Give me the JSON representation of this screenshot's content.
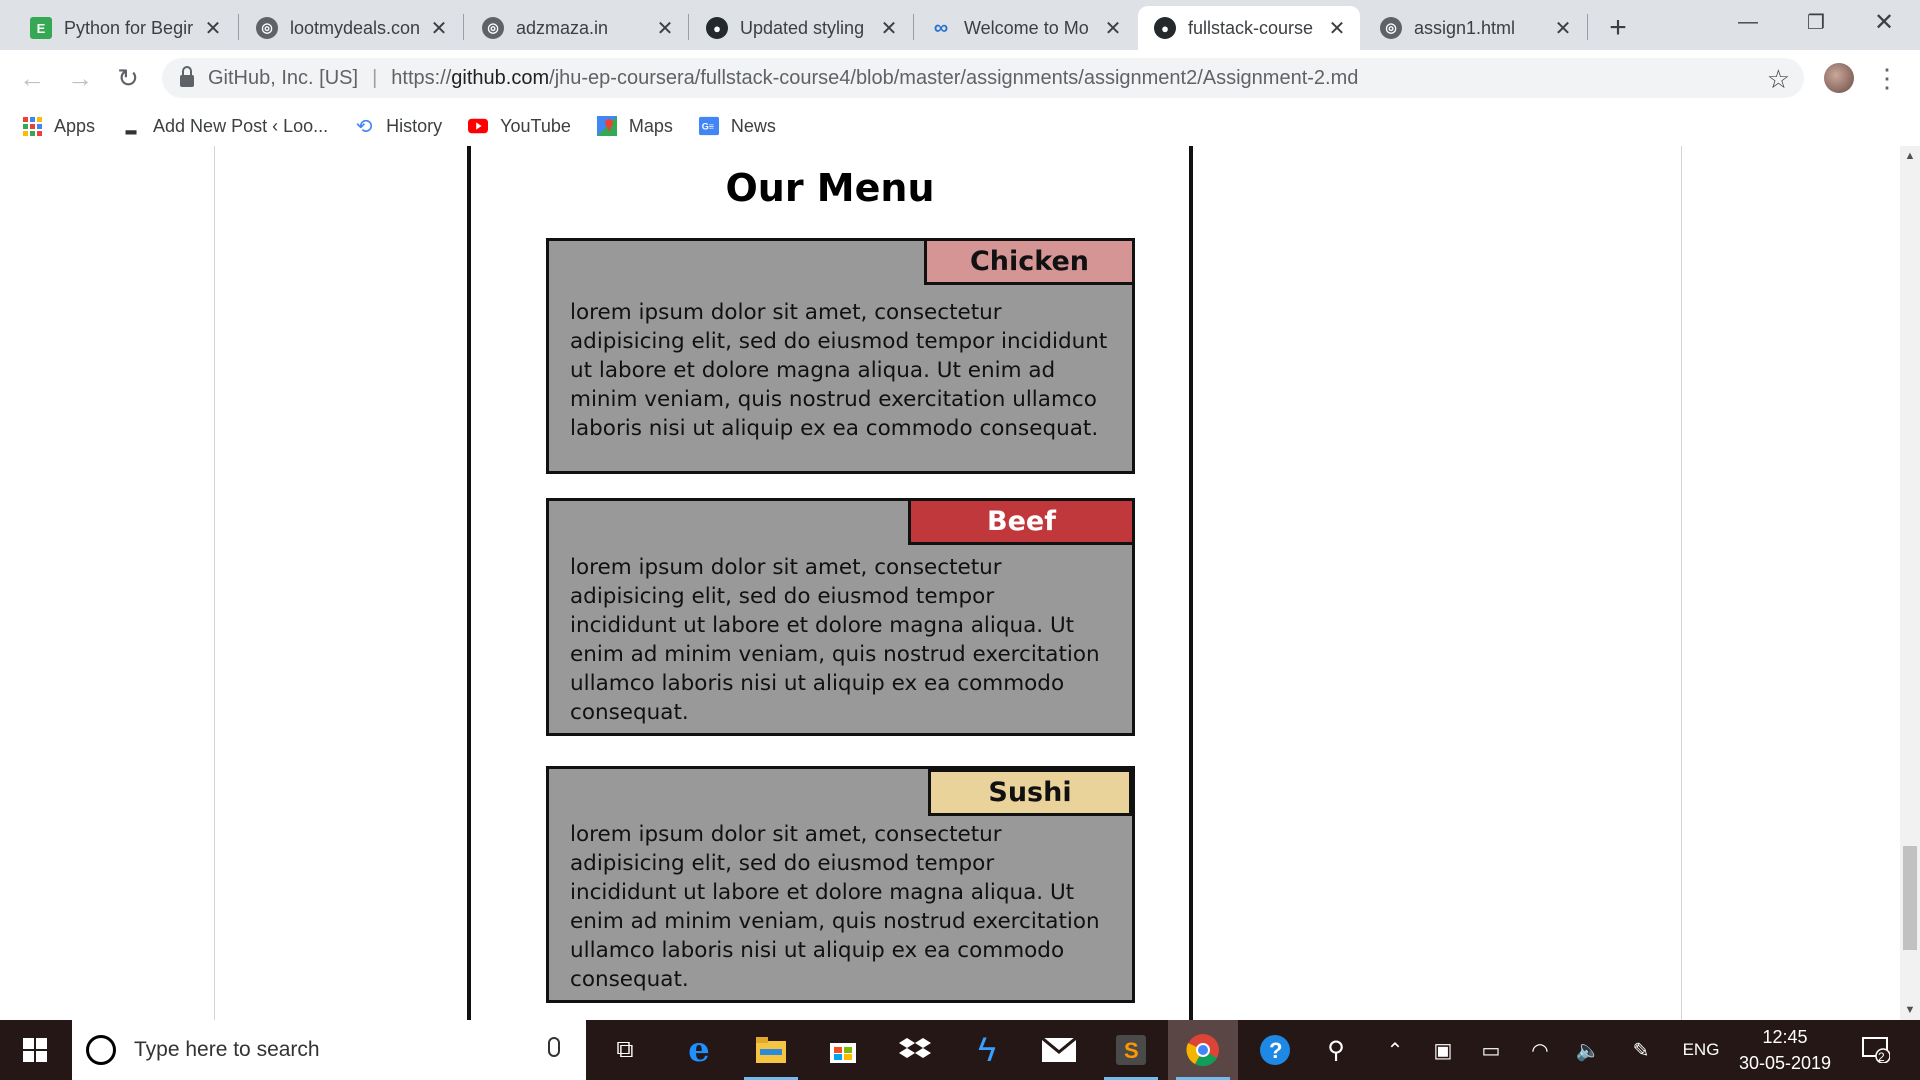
{
  "browser": {
    "tabs": [
      {
        "title": "Python for Begir",
        "favicon_color": "#34a853",
        "favicon_glyph": "E"
      },
      {
        "title": "lootmydeals.con",
        "favicon_color": "#5f6368",
        "favicon_glyph": "globe"
      },
      {
        "title": "adzmaza.in",
        "favicon_color": "#5f6368",
        "favicon_glyph": "globe"
      },
      {
        "title": "Updated styling",
        "favicon_color": "#24292e",
        "favicon_glyph": "github"
      },
      {
        "title": "Welcome to Mo",
        "favicon_color": "#2a73cc",
        "favicon_glyph": "∞"
      },
      {
        "title": "fullstack-course",
        "favicon_color": "#24292e",
        "favicon_glyph": "github"
      },
      {
        "title": "assign1.html",
        "favicon_color": "#5f6368",
        "favicon_glyph": "globe"
      }
    ],
    "active_tab_index": 5,
    "address": {
      "org": "GitHub, Inc. [US]",
      "url_prefix": "https://",
      "url_host": "github.com",
      "url_path": "/jhu-ep-coursera/fullstack-course4/blob/master/assignments/assignment2/Assignment-2.md"
    },
    "bookmarks": [
      {
        "label": "Apps",
        "icon": "apps-grid-icon"
      },
      {
        "label": "Add New Post ‹ Loo...",
        "icon": "shoe-icon"
      },
      {
        "label": "History",
        "icon": "history-icon"
      },
      {
        "label": "YouTube",
        "icon": "youtube-icon"
      },
      {
        "label": "Maps",
        "icon": "maps-icon"
      },
      {
        "label": "News",
        "icon": "news-icon"
      }
    ]
  },
  "page": {
    "heading": "Our Menu",
    "cards": [
      {
        "label": "Chicken",
        "label_color": "#d59595",
        "text_lines": [
          "lorem ipsum dolor sit amet, consectetur",
          "adipisicing elit, sed do eiusmod tempor incididunt",
          "ut labore et dolore magna aliqua. Ut enim ad",
          "minim veniam, quis nostrud exercitation ullamco",
          "laboris nisi ut aliquip ex ea commodo consequat."
        ]
      },
      {
        "label": "Beef",
        "label_color": "#c0383c",
        "label_text_color": "#ffffff",
        "text_lines": [
          "lorem ipsum dolor sit amet, consectetur",
          "adipisicing elit, sed do eiusmod tempor",
          "incididunt ut labore et dolore magna aliqua. Ut",
          "enim ad minim veniam, quis nostrud exercitation",
          "ullamco laboris nisi ut aliquip ex ea commodo",
          "consequat."
        ]
      },
      {
        "label": "Sushi",
        "label_color": "#e9d39a",
        "text_lines": [
          "lorem ipsum dolor sit amet, consectetur",
          "adipisicing elit, sed do eiusmod tempor",
          "incididunt ut labore et dolore magna aliqua. Ut",
          "enim ad minim veniam, quis nostrud exercitation",
          "ullamco laboris nisi ut aliquip ex ea commodo",
          "consequat."
        ]
      }
    ]
  },
  "taskbar": {
    "search_placeholder": "Type here to search",
    "language": "ENG",
    "time": "12:45",
    "date": "30-05-2019",
    "notification_count": "2"
  }
}
